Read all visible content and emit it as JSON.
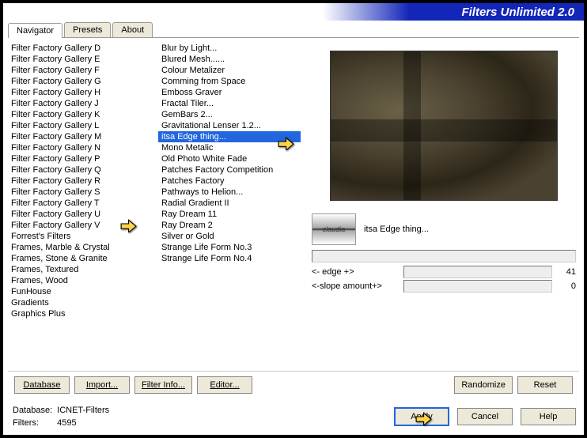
{
  "title": "Filters Unlimited 2.0",
  "tabs": {
    "navigator": "Navigator",
    "presets": "Presets",
    "about": "About"
  },
  "categories": [
    "Filter Factory Gallery D",
    "Filter Factory Gallery E",
    "Filter Factory Gallery F",
    "Filter Factory Gallery G",
    "Filter Factory Gallery H",
    "Filter Factory Gallery J",
    "Filter Factory Gallery K",
    "Filter Factory Gallery L",
    "Filter Factory Gallery M",
    "Filter Factory Gallery N",
    "Filter Factory Gallery P",
    "Filter Factory Gallery Q",
    "Filter Factory Gallery R",
    "Filter Factory Gallery S",
    "Filter Factory Gallery T",
    "Filter Factory Gallery U",
    "Filter Factory Gallery V",
    "Forrest's Filters",
    "Frames, Marble & Crystal",
    "Frames, Stone & Granite",
    "Frames, Textured",
    "Frames, Wood",
    "FunHouse",
    "Gradients",
    "Graphics Plus"
  ],
  "filters": [
    "Blur by Light...",
    "Blured Mesh......",
    "Colour Metalizer",
    "Comming from Space",
    "Emboss Graver",
    "Fractal Tiler...",
    "GemBars 2...",
    "Gravitational Lenser 1.2...",
    "itsa Edge thing...",
    "Mono Metalic",
    "Old Photo White Fade",
    "Patches Factory Competition",
    "Patches Factory",
    "Pathways to Helion...",
    "Radial Gradient II",
    "Ray Dream 11",
    "Ray Dream 2",
    "Silver or Gold",
    "Strange Life Form No.3",
    "Strange Life Form No.4"
  ],
  "selectedFilter": "itsa Edge thing...",
  "watermark": "claudia",
  "params": [
    {
      "label": "<- edge +>",
      "value": "41"
    },
    {
      "label": "<-slope amount+>",
      "value": "0"
    }
  ],
  "toolbar": {
    "database": "Database",
    "import": "Import...",
    "filterinfo": "Filter Info...",
    "editor": "Editor...",
    "randomize": "Randomize",
    "reset": "Reset"
  },
  "footer": {
    "dbLabel": "Database:",
    "dbValue": "ICNET-Filters",
    "filtersLabel": "Filters:",
    "filtersValue": "4595"
  },
  "dlg": {
    "apply": "Apply",
    "cancel": "Cancel",
    "help": "Help"
  }
}
